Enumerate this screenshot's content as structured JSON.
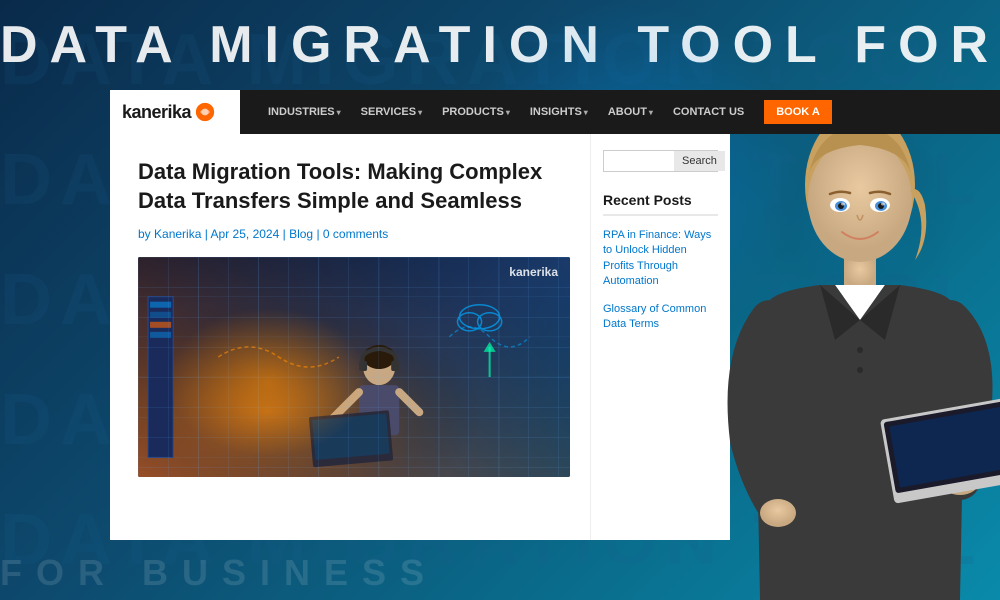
{
  "background": {
    "header_text": "DATA MIGRATION TOOL FOR BUSINESS",
    "bg_lines": [
      "DATA MIGRATION TOOL FOR BUSINES",
      "DATA MIGRATION TOOL FOR BUSINES",
      "DATA MIGRATION TOOL FOR BUSINES",
      "DATA MIGRATION TOOL FOR BUSINES",
      "DATA MIGRATION TOOL FOR BUSINES"
    ],
    "bottom_text": "FOR BUSINESS"
  },
  "navbar": {
    "logo_text": "kanerika",
    "items": [
      {
        "label": "INDUSTRIES",
        "has_dropdown": true
      },
      {
        "label": "SERVICES",
        "has_dropdown": true
      },
      {
        "label": "PRODUCTS",
        "has_dropdown": true
      },
      {
        "label": "INSIGHTS",
        "has_dropdown": true
      },
      {
        "label": "ABOUT",
        "has_dropdown": true
      }
    ],
    "contact_label": "CONTACT US",
    "book_label": "BOOK A"
  },
  "article": {
    "title": "Data Migration Tools: Making Complex Data Transfers Simple and Seamless",
    "meta": {
      "prefix": "by",
      "author": "Kanerika",
      "separator1": "|",
      "date": "Apr 25, 2024",
      "separator2": "|",
      "category": "Blog",
      "separator3": "|",
      "comments": "0 comments"
    },
    "image_watermark": "kanerika"
  },
  "sidebar": {
    "search_placeholder": "",
    "search_button_label": "Search",
    "recent_posts_title": "Recent Posts",
    "posts": [
      {
        "title": "RPA in Finance: Ways to Unlock Hidden Profits Through Automation"
      },
      {
        "title": "Glossary of Common Data Terms"
      }
    ]
  }
}
